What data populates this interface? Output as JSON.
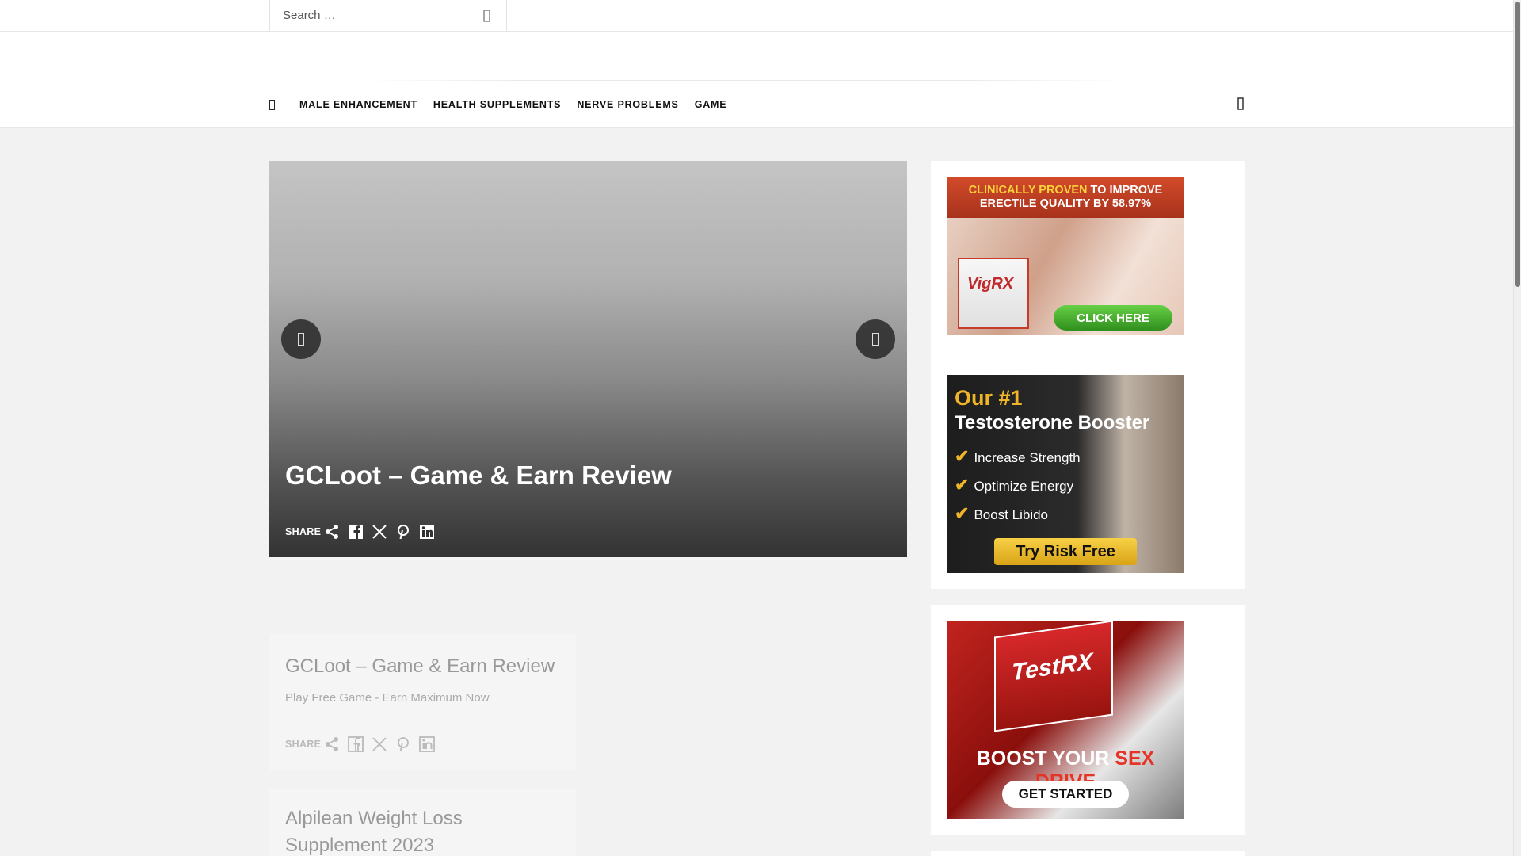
{
  "search": {
    "placeholder": "Search …"
  },
  "nav": {
    "items": [
      {
        "label": "MALE ENHANCEMENT"
      },
      {
        "label": "HEALTH SUPPLEMENTS"
      },
      {
        "label": "NERVE PROBLEMS"
      },
      {
        "label": "GAME"
      }
    ]
  },
  "hero": {
    "title": "GCLoot – Game & Earn Review",
    "share_label": "SHARE"
  },
  "posts": [
    {
      "title": "GCLoot – Game & Earn Review",
      "excerpt": "Play Free Game - Earn Maximum Now",
      "share_label": "SHARE"
    },
    {
      "title": "Alpilean Weight Loss Supplement 2023"
    }
  ],
  "sidebar": {
    "ad1": {
      "headline_highlight": "CLINICALLY PROVEN",
      "headline_rest": " TO IMPROVE",
      "headline_line2": "ERECTILE QUALITY BY 58.97%",
      "product": "VigRX",
      "cta": "CLICK HERE"
    },
    "ad2": {
      "line1": "Our #1",
      "line2": "Testosterone Booster",
      "benefits": [
        "Increase Strength",
        "Optimize Energy",
        "Boost Libido"
      ],
      "cta": "Try Risk Free"
    },
    "ad3": {
      "product": "TestRX",
      "tag_white": "BOOST YOUR ",
      "tag_red": "SEX DRIVE",
      "cta": "GET STARTED"
    }
  },
  "colors": {
    "accent_red": "#c53b2c",
    "accent_gold": "#f0b429",
    "cta_green": "#3ea42a"
  }
}
